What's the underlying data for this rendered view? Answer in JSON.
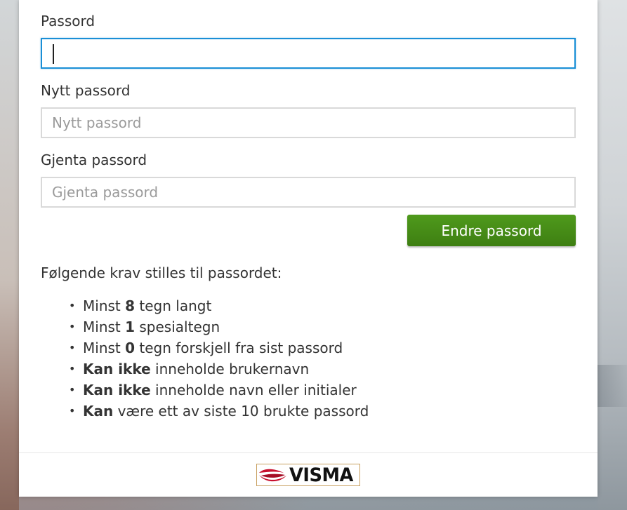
{
  "form": {
    "password": {
      "label": "Passord",
      "value": "",
      "placeholder": ""
    },
    "new_password": {
      "label": "Nytt passord",
      "value": "",
      "placeholder": "Nytt passord"
    },
    "repeat_password": {
      "label": "Gjenta passord",
      "value": "",
      "placeholder": "Gjenta passord"
    },
    "submit_label": "Endre passord"
  },
  "requirements": {
    "intro": "Følgende krav stilles til passordet:",
    "items": [
      {
        "pre": "Minst ",
        "bold": "8",
        "post": " tegn langt"
      },
      {
        "pre": "Minst ",
        "bold": "1",
        "post": " spesialtegn"
      },
      {
        "pre": "Minst ",
        "bold": "0",
        "post": " tegn forskjell fra sist passord"
      },
      {
        "pre": "",
        "bold": "Kan ikke",
        "post": " inneholde brukernavn"
      },
      {
        "pre": "",
        "bold": "Kan ikke",
        "post": " inneholde navn eller initialer"
      },
      {
        "pre": "",
        "bold": "Kan",
        "post": " være ett av siste 10 brukte passord"
      }
    ],
    "bullet": "•"
  },
  "footer": {
    "logo_text": "VISMA",
    "logo_icon": "visma-logo-icon"
  },
  "colors": {
    "accent_focus": "#1a8fd6",
    "button_green": "#4f9a1c",
    "logo_red": "#c8102e"
  }
}
